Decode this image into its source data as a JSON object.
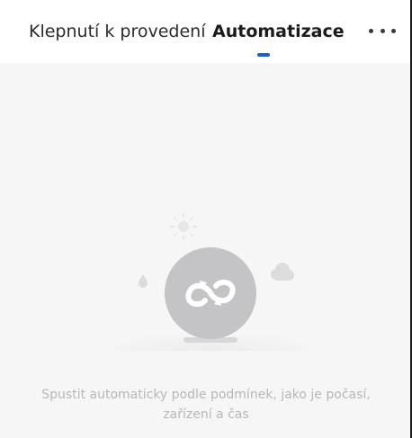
{
  "tabs": [
    {
      "label": "Klepnutí k provedení",
      "active": false
    },
    {
      "label": "Automatizace",
      "active": true
    }
  ],
  "header": {
    "more_icon": "more-horizontal-icon"
  },
  "empty_state": {
    "icon": "automation-loop-icon",
    "decorations": [
      "sun-icon",
      "raindrop-icon",
      "cloud-icon"
    ],
    "message": "Spustit automaticky podle podmínek, jako je počasí, zařízení a čas"
  },
  "colors": {
    "accent": "#1f5fc9",
    "background": "#f6f6f7",
    "icon_circle": "#c4c4c6",
    "muted_text": "#b6b7b9"
  }
}
